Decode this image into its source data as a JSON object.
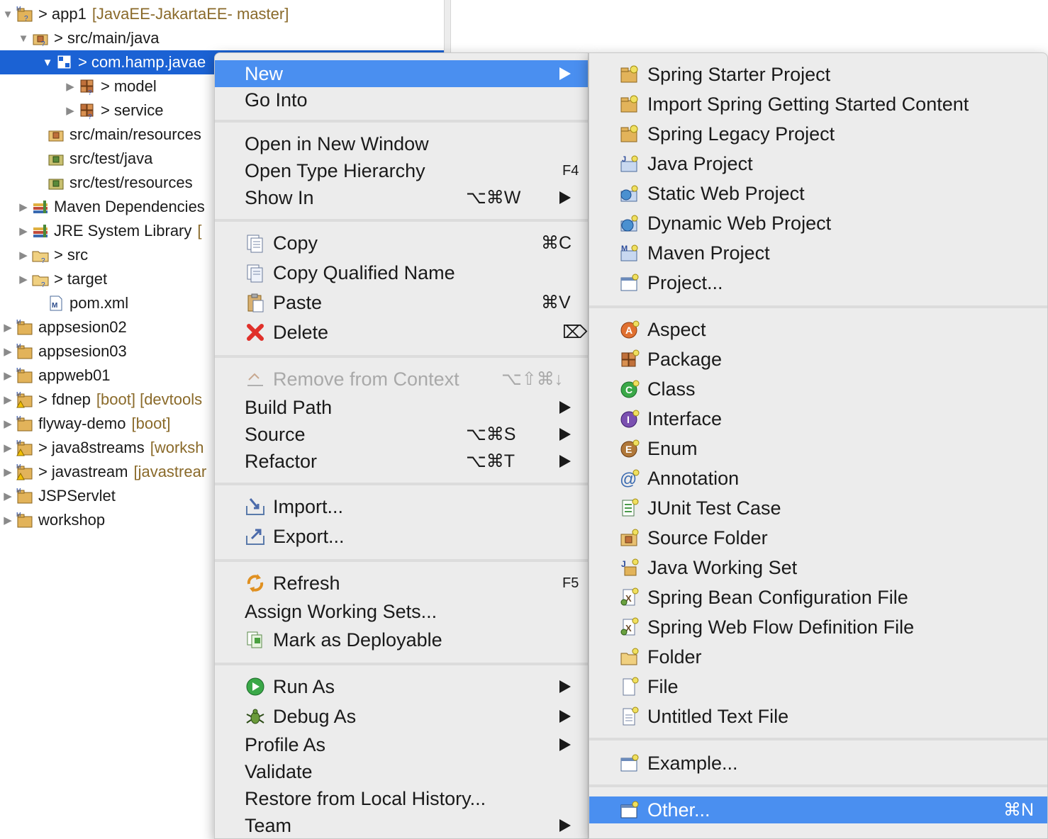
{
  "tree": {
    "rows": [
      {
        "prefix": ">",
        "label": "app1",
        "deco": "[JavaEE-JakartaEE- master]"
      },
      {
        "prefix": ">",
        "label": "src/main/java",
        "deco": ""
      },
      {
        "prefix": ">",
        "label": "com.hamp.javae",
        "deco": ""
      },
      {
        "prefix": ">",
        "label": "model",
        "deco": ""
      },
      {
        "prefix": ">",
        "label": "service",
        "deco": ""
      },
      {
        "prefix": "",
        "label": "src/main/resources",
        "deco": ""
      },
      {
        "prefix": "",
        "label": "src/test/java",
        "deco": ""
      },
      {
        "prefix": "",
        "label": "src/test/resources",
        "deco": ""
      },
      {
        "prefix": "",
        "label": "Maven Dependencies",
        "deco": ""
      },
      {
        "prefix": "",
        "label": "JRE System Library",
        "deco": "["
      },
      {
        "prefix": ">",
        "label": "src",
        "deco": ""
      },
      {
        "prefix": ">",
        "label": "target",
        "deco": ""
      },
      {
        "prefix": "",
        "label": "pom.xml",
        "deco": ""
      },
      {
        "prefix": "",
        "label": "appsesion02",
        "deco": ""
      },
      {
        "prefix": "",
        "label": "appsesion03",
        "deco": ""
      },
      {
        "prefix": "",
        "label": "appweb01",
        "deco": ""
      },
      {
        "prefix": ">",
        "label": "fdnep",
        "deco": "[boot] [devtools"
      },
      {
        "prefix": "",
        "label": "flyway-demo",
        "deco": "[boot]"
      },
      {
        "prefix": ">",
        "label": "java8streams",
        "deco": "[worksh"
      },
      {
        "prefix": ">",
        "label": "javastream",
        "deco": "[javastrear"
      },
      {
        "prefix": "",
        "label": "JSPServlet",
        "deco": ""
      },
      {
        "prefix": "",
        "label": "workshop",
        "deco": ""
      }
    ]
  },
  "context_menu": {
    "items": [
      {
        "label": "New",
        "shortcut": ""
      },
      {
        "label": "Go Into",
        "shortcut": ""
      },
      {
        "label": "Open in New Window",
        "shortcut": ""
      },
      {
        "label": "Open Type Hierarchy",
        "shortcut": "F4"
      },
      {
        "label": "Show In",
        "shortcut": "⌥⌘W"
      },
      {
        "label": "Copy",
        "shortcut": "⌘C"
      },
      {
        "label": "Copy Qualified Name",
        "shortcut": ""
      },
      {
        "label": "Paste",
        "shortcut": "⌘V"
      },
      {
        "label": "Delete",
        "shortcut": "⌦"
      },
      {
        "label": "Remove from Context",
        "shortcut": "⌥⇧⌘↓"
      },
      {
        "label": "Build Path",
        "shortcut": ""
      },
      {
        "label": "Source",
        "shortcut": "⌥⌘S"
      },
      {
        "label": "Refactor",
        "shortcut": "⌥⌘T"
      },
      {
        "label": "Import...",
        "shortcut": ""
      },
      {
        "label": "Export...",
        "shortcut": ""
      },
      {
        "label": "Refresh",
        "shortcut": "F5"
      },
      {
        "label": "Assign Working Sets...",
        "shortcut": ""
      },
      {
        "label": "Mark as Deployable",
        "shortcut": ""
      },
      {
        "label": "Run As",
        "shortcut": ""
      },
      {
        "label": "Debug As",
        "shortcut": ""
      },
      {
        "label": "Profile As",
        "shortcut": ""
      },
      {
        "label": "Validate",
        "shortcut": ""
      },
      {
        "label": "Restore from Local History...",
        "shortcut": ""
      },
      {
        "label": "Team",
        "shortcut": ""
      }
    ]
  },
  "new_submenu": {
    "items": [
      {
        "label": "Spring Starter Project",
        "shortcut": ""
      },
      {
        "label": "Import Spring Getting Started Content",
        "shortcut": ""
      },
      {
        "label": "Spring Legacy Project",
        "shortcut": ""
      },
      {
        "label": "Java Project",
        "shortcut": ""
      },
      {
        "label": "Static Web Project",
        "shortcut": ""
      },
      {
        "label": "Dynamic Web Project",
        "shortcut": ""
      },
      {
        "label": "Maven Project",
        "shortcut": ""
      },
      {
        "label": "Project...",
        "shortcut": ""
      },
      {
        "label": "Aspect",
        "shortcut": ""
      },
      {
        "label": "Package",
        "shortcut": ""
      },
      {
        "label": "Class",
        "shortcut": ""
      },
      {
        "label": "Interface",
        "shortcut": ""
      },
      {
        "label": "Enum",
        "shortcut": ""
      },
      {
        "label": "Annotation",
        "shortcut": ""
      },
      {
        "label": "JUnit Test Case",
        "shortcut": ""
      },
      {
        "label": "Source Folder",
        "shortcut": ""
      },
      {
        "label": "Java Working Set",
        "shortcut": ""
      },
      {
        "label": "Spring Bean Configuration File",
        "shortcut": ""
      },
      {
        "label": "Spring Web Flow Definition File",
        "shortcut": ""
      },
      {
        "label": "Folder",
        "shortcut": ""
      },
      {
        "label": "File",
        "shortcut": ""
      },
      {
        "label": "Untitled Text File",
        "shortcut": ""
      },
      {
        "label": "Example...",
        "shortcut": ""
      },
      {
        "label": "Other...",
        "shortcut": "⌘N"
      }
    ]
  },
  "colors": {
    "selection": "#1b62d4",
    "menu_highlight": "#4a8ff0",
    "menu_bg": "#ececec",
    "decoration_text": "#8a6a2a"
  }
}
